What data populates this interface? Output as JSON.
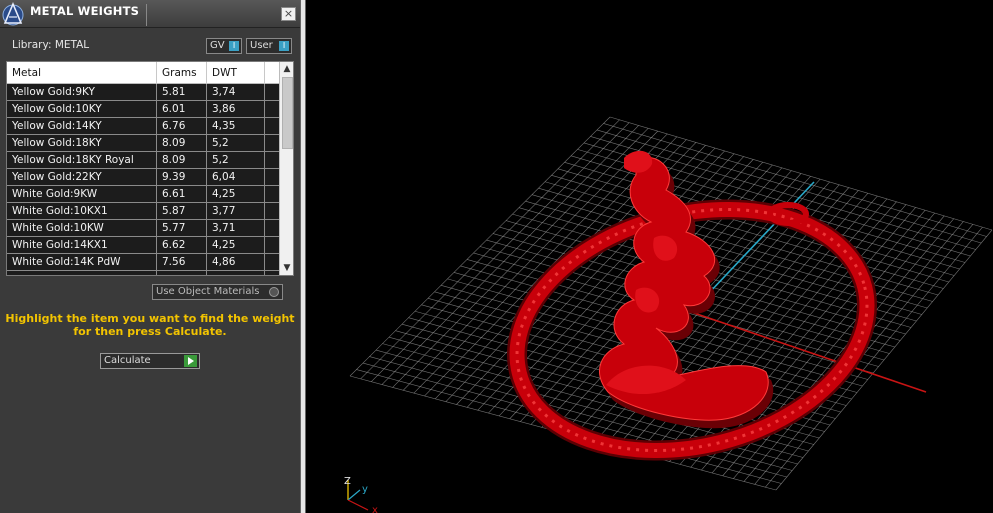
{
  "panel": {
    "title": "METAL WEIGHTS",
    "close_glyph": "×",
    "library_label": "Library: METAL",
    "toggles": [
      {
        "label": "GV",
        "knob": "I"
      },
      {
        "label": "User",
        "knob": "I"
      }
    ],
    "columns": [
      "Metal",
      "Grams",
      "DWT"
    ],
    "rows": [
      {
        "metal": "Yellow Gold:9KY",
        "grams": "5.81",
        "dwt": "3,74"
      },
      {
        "metal": "Yellow Gold:10KY",
        "grams": "6.01",
        "dwt": "3,86"
      },
      {
        "metal": "Yellow Gold:14KY",
        "grams": "6.76",
        "dwt": "4,35"
      },
      {
        "metal": "Yellow Gold:18KY",
        "grams": "8.09",
        "dwt": "5,2"
      },
      {
        "metal": "Yellow Gold:18KY Royal",
        "grams": "8.09",
        "dwt": "5,2"
      },
      {
        "metal": "Yellow Gold:22KY",
        "grams": "9.39",
        "dwt": "6,04"
      },
      {
        "metal": "White Gold:9KW",
        "grams": "6.61",
        "dwt": "4,25"
      },
      {
        "metal": "White Gold:10KX1",
        "grams": "5.87",
        "dwt": "3,77"
      },
      {
        "metal": "White Gold:10KW",
        "grams": "5.77",
        "dwt": "3,71"
      },
      {
        "metal": "White Gold:14KX1",
        "grams": "6.62",
        "dwt": "4,25"
      },
      {
        "metal": "White Gold:14K PdW",
        "grams": "7.56",
        "dwt": "4,86"
      }
    ],
    "use_object_materials": "Use Object Materials",
    "hint_line1": "Highlight the item you want to find the weight",
    "hint_line2": "for then press Calculate.",
    "calculate_label": "Calculate"
  },
  "viewport": {
    "axis_labels": {
      "z": "Z",
      "y": "y",
      "x": "x"
    },
    "colors": {
      "model": "#c8000a",
      "grid": "#9a9a9a",
      "axis_x": "#c81414",
      "axis_y": "#2aa8c8"
    }
  }
}
